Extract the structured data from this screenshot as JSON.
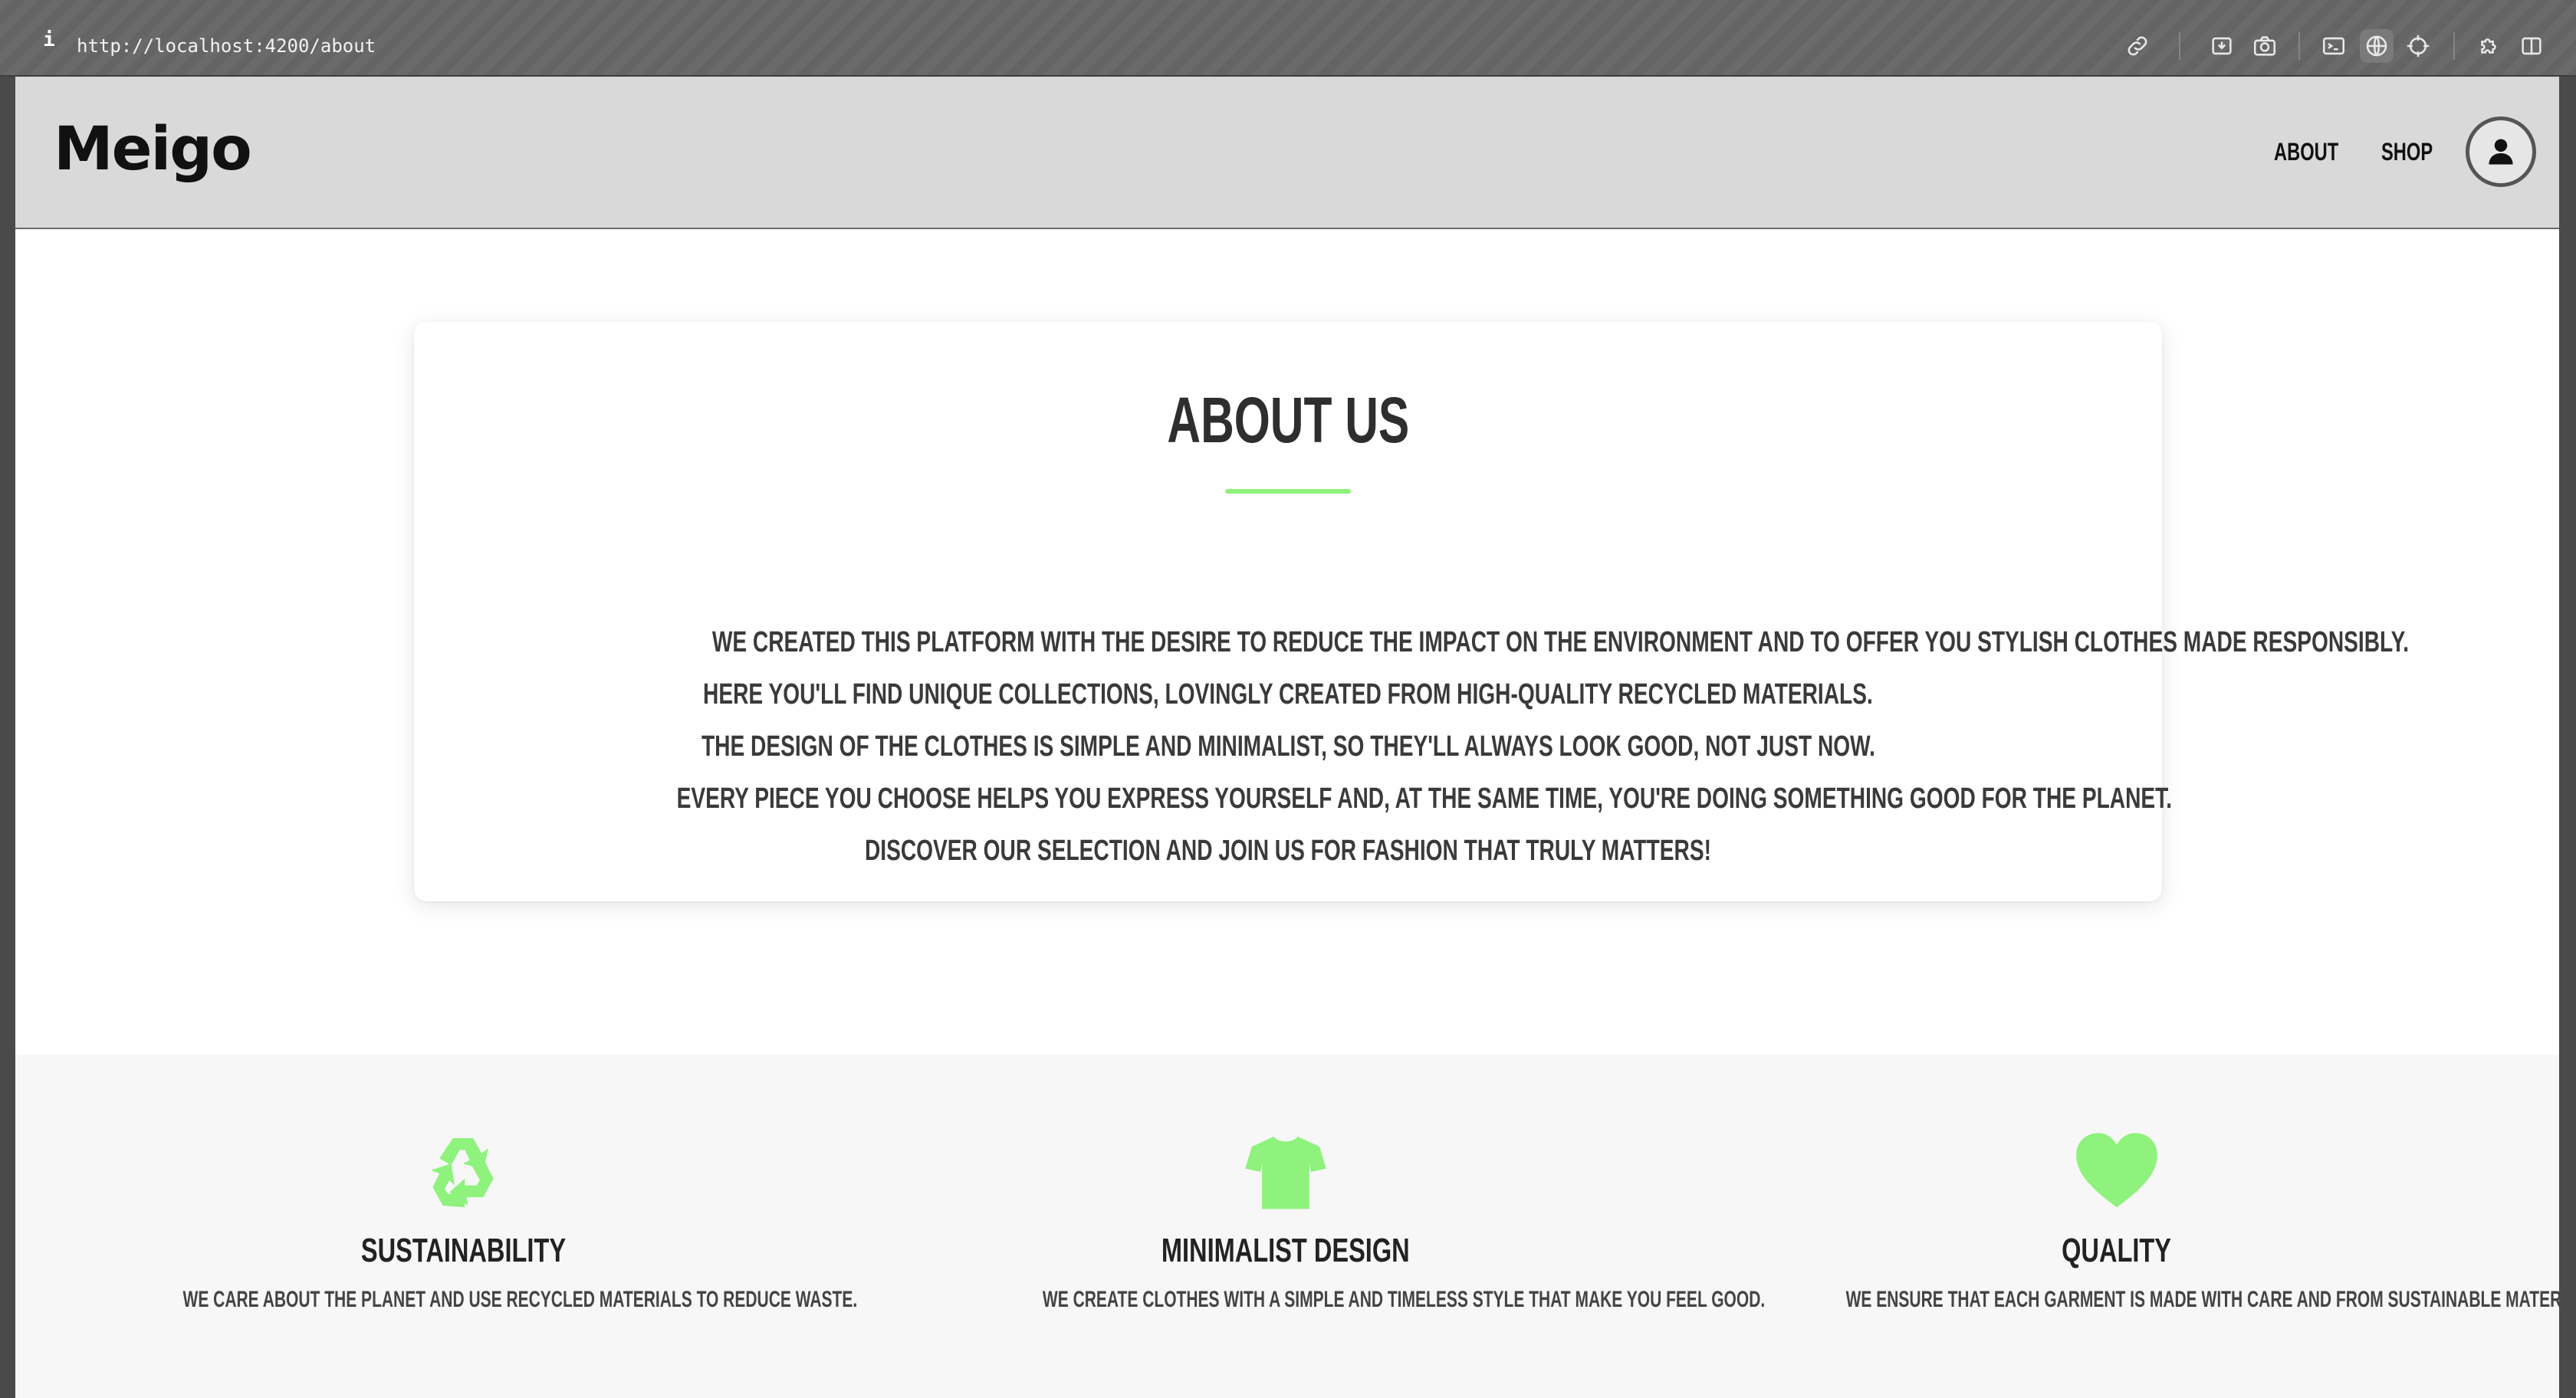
{
  "browser": {
    "info_label": "i",
    "url": "http://localhost:4200/about",
    "toolbar_icons": [
      "link-icon",
      "download-page-icon",
      "camera-icon",
      "terminal-icon",
      "globe-icon",
      "crosshair-icon",
      "extensions-icon",
      "split-view-icon"
    ]
  },
  "header": {
    "logo": "Meigo",
    "nav": {
      "about": "ABOUT",
      "shop": "SHOP"
    },
    "avatar_icon": "user-icon"
  },
  "about": {
    "title": "ABOUT US",
    "accent_color": "#8ef27c",
    "paragraphs": [
      "WE CREATED THIS PLATFORM WITH THE DESIRE TO REDUCE THE IMPACT ON THE ENVIRONMENT AND TO OFFER YOU STYLISH CLOTHES MADE RESPONSIBLY.",
      "HERE YOU'LL FIND UNIQUE COLLECTIONS, LOVINGLY CREATED FROM HIGH-QUALITY RECYCLED MATERIALS.",
      "THE DESIGN OF THE CLOTHES IS SIMPLE AND MINIMALIST, SO THEY'LL ALWAYS LOOK GOOD, NOT JUST NOW.",
      "EVERY PIECE YOU CHOOSE HELPS YOU EXPRESS YOURSELF AND, AT THE SAME TIME, YOU'RE DOING SOMETHING GOOD FOR THE PLANET.",
      "DISCOVER OUR SELECTION AND JOIN US FOR FASHION THAT TRULY MATTERS!"
    ]
  },
  "features": [
    {
      "icon": "recycle-icon",
      "title": "SUSTAINABILITY",
      "description": "WE CARE ABOUT THE PLANET AND USE RECYCLED MATERIALS TO REDUCE WASTE."
    },
    {
      "icon": "tshirt-icon",
      "title": "MINIMALIST DESIGN",
      "description": "WE CREATE CLOTHES WITH A SIMPLE AND TIMELESS STYLE THAT MAKE YOU FEEL GOOD."
    },
    {
      "icon": "heart-icon",
      "title": "QUALITY",
      "description": "WE ENSURE THAT EACH GARMENT IS MADE WITH CARE AND FROM SUSTAINABLE MATERIALS."
    }
  ]
}
